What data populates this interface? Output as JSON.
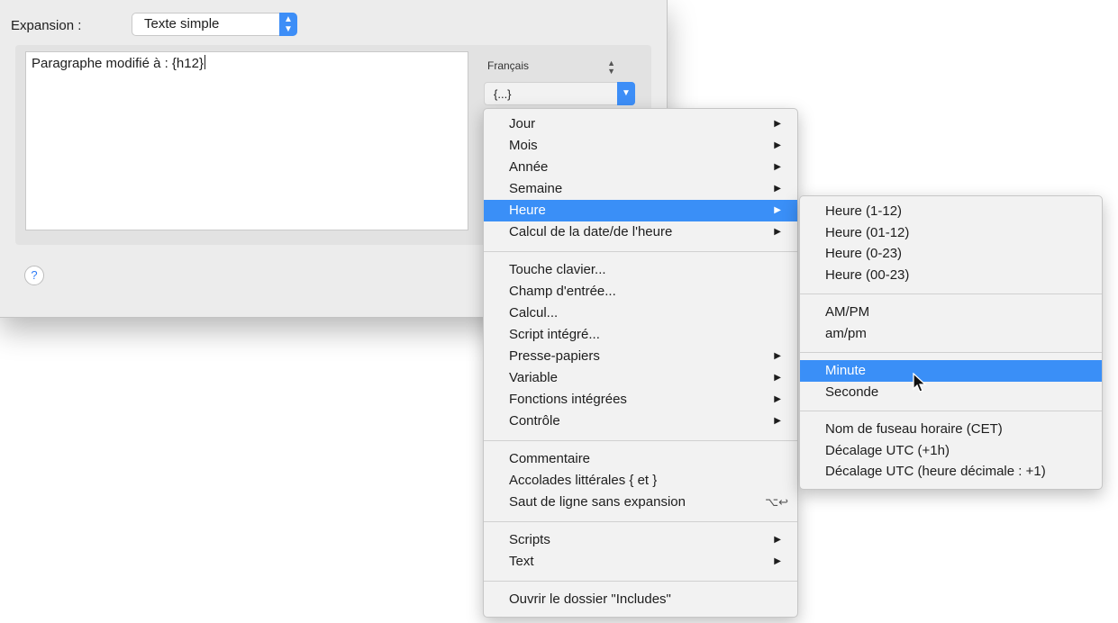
{
  "expansion": {
    "label": "Expansion :",
    "popup_value": "Texte simple",
    "popup_arrows_icon": "up-down-chevrons-icon"
  },
  "editor": {
    "text": "Paragraphe modifié à : {h12}"
  },
  "language": {
    "value": "Français",
    "arrows_icon": "up-down-chevrons-icon"
  },
  "placeholder_button": {
    "label": "{...}",
    "arrow_icon": "chevron-down-icon"
  },
  "help": {
    "label": "?"
  },
  "main_menu": {
    "groups": [
      [
        {
          "label": "Jour",
          "submenu": true
        },
        {
          "label": "Mois",
          "submenu": true
        },
        {
          "label": "Année",
          "submenu": true
        },
        {
          "label": "Semaine",
          "submenu": true
        },
        {
          "label": "Heure",
          "submenu": true,
          "highlighted": true
        },
        {
          "label": "Calcul de la date/de l'heure",
          "submenu": true
        }
      ],
      [
        {
          "label": "Touche clavier..."
        },
        {
          "label": "Champ d'entrée..."
        },
        {
          "label": "Calcul..."
        },
        {
          "label": "Script intégré..."
        },
        {
          "label": "Presse-papiers",
          "submenu": true
        },
        {
          "label": "Variable",
          "submenu": true
        },
        {
          "label": "Fonctions intégrées",
          "submenu": true
        },
        {
          "label": "Contrôle",
          "submenu": true
        }
      ],
      [
        {
          "label": "Commentaire"
        },
        {
          "label": "Accolades littérales { et }"
        },
        {
          "label": "Saut de ligne sans expansion",
          "shortcut": "⌥↩"
        }
      ],
      [
        {
          "label": "Scripts",
          "submenu": true
        },
        {
          "label": "Text",
          "submenu": true
        }
      ],
      [
        {
          "label": "Ouvrir le dossier \"Includes\""
        }
      ]
    ]
  },
  "heure_submenu": {
    "groups": [
      [
        {
          "label": "Heure (1-12)"
        },
        {
          "label": "Heure (01-12)"
        },
        {
          "label": "Heure (0-23)"
        },
        {
          "label": "Heure (00-23)"
        }
      ],
      [
        {
          "label": "AM/PM"
        },
        {
          "label": "am/pm"
        }
      ],
      [
        {
          "label": "Minute",
          "highlighted": true
        },
        {
          "label": "Seconde"
        }
      ],
      [
        {
          "label": "Nom de fuseau horaire (CET)"
        },
        {
          "label": "Décalage UTC (+1h)"
        },
        {
          "label": "Décalage UTC (heure décimale : +1)"
        }
      ]
    ]
  },
  "colors": {
    "accent": "#3a8ff7",
    "menu_bg": "#f2f2f2",
    "window_bg": "#ececec"
  }
}
